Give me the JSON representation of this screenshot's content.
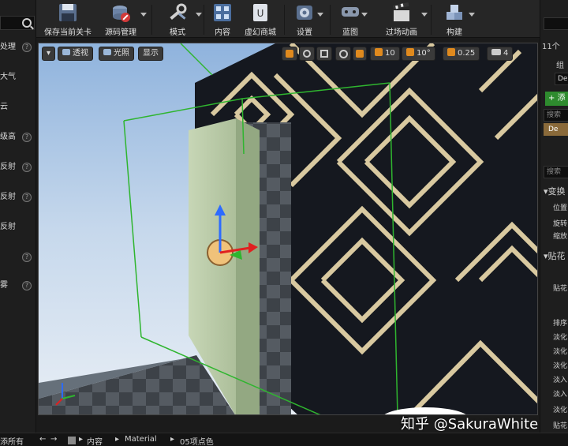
{
  "left_panel": {
    "items": [
      {
        "label": "处理",
        "has_help": true
      },
      {
        "label": "大气",
        "has_help": false
      },
      {
        "label": "云",
        "has_help": false
      },
      {
        "label": "级高",
        "has_help": true
      },
      {
        "label": "反射",
        "has_help": true
      },
      {
        "label": "反射",
        "has_help": true
      },
      {
        "label": "反射",
        "has_help": false
      },
      {
        "label": "",
        "has_help": true
      },
      {
        "label": "雾",
        "has_help": true
      }
    ],
    "help_glyph": "?"
  },
  "toolbar": {
    "buttons": [
      {
        "label": "保存当前关卡",
        "icon": "save-disk-icon"
      },
      {
        "label": "源码管理",
        "icon": "source-control-icon"
      },
      {
        "label": "模式",
        "icon": "modes-icon"
      },
      {
        "label": "内容",
        "icon": "content-icon"
      },
      {
        "label": "虚幻商城",
        "icon": "marketplace-icon"
      },
      {
        "label": "设置",
        "icon": "settings-gear-icon"
      },
      {
        "label": "蓝图",
        "icon": "blueprint-icon"
      },
      {
        "label": "过场动画",
        "icon": "clapperboard-icon"
      },
      {
        "label": "构建",
        "icon": "build-cubes-icon"
      }
    ]
  },
  "viewport": {
    "menu_label": "▾",
    "perspective_label": "透视",
    "lighting_label": "光照",
    "show_label": "显示",
    "snap_grid_value": "10",
    "snap_rotation_value": "10°",
    "snap_scale_value": "0.25",
    "camera_speed_value": "4"
  },
  "right_panel": {
    "row1": "11个",
    "row2": "组",
    "row3": "De",
    "add_button": "添",
    "search1": "搜索",
    "selected": "De",
    "search2": "搜索",
    "transform_section": "变换",
    "location": "位置",
    "rotation": "旋转",
    "scale": "缩放",
    "decal_section": "贴花",
    "decal_material": "贴花",
    "sort_order": "排序",
    "fade_screen_size": "淡化",
    "fade_start_delay": "淡化",
    "fade_duration": "淡化",
    "fade_in_duration": "淡入",
    "fade_in_start": "淡入",
    "destroy_owner": "淡化",
    "extra": "贴花"
  },
  "bottom_bar": {
    "left_text": "添所有",
    "nav_back": "←",
    "nav_forward": "→",
    "crumb_content": "内容",
    "crumb_material": "Material",
    "crumb_folder": "05项点色",
    "sep": "▸"
  },
  "watermark": "知乎 @SakuraWhite",
  "colors": {
    "accent_orange": "#e08a1e",
    "selection_green": "#2fb52f",
    "gizmo_blue": "#2d6bff",
    "gizmo_red": "#e02020"
  }
}
